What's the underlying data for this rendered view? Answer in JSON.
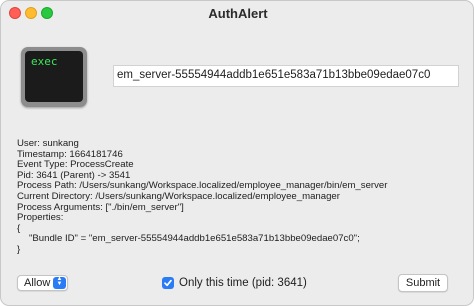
{
  "window": {
    "title": "AuthAlert"
  },
  "icon": {
    "terminal_text": "exec"
  },
  "process_field": {
    "value": "em_server-55554944addb1e651e583a71b13bbe09edae07c0"
  },
  "details": {
    "user": "User: sunkang",
    "timestamp": "Timestamp: 1664181746",
    "event_type": "Event Type: ProcessCreate",
    "pid": "Pid: 3641 (Parent) -> 3541",
    "process_path": "Process Path: /Users/sunkang/Workspace.localized/employee_manager/bin/em_server",
    "current_directory": "Current Directory: /Users/sunkang/Workspace.localized/employee_manager",
    "process_arguments": "Process Arguments: [\"./bin/em_server\"]",
    "properties_label": "Properties:",
    "open_brace": "{",
    "bundle_id": "\"Bundle ID\" = \"em_server-55554944addb1e651e583a71b13bbe09edae07c0\";",
    "close_brace": "}"
  },
  "footer": {
    "action_selected": "Allow",
    "only_this_time_label": "Only this time (pid: 3641)",
    "only_this_time_checked": true,
    "submit_label": "Submit"
  },
  "colors": {
    "accent": "#2a7cf6",
    "terminal_text": "#3ce65a",
    "close": "#ff5f57",
    "minimize": "#febc2e",
    "zoom": "#28c840"
  }
}
